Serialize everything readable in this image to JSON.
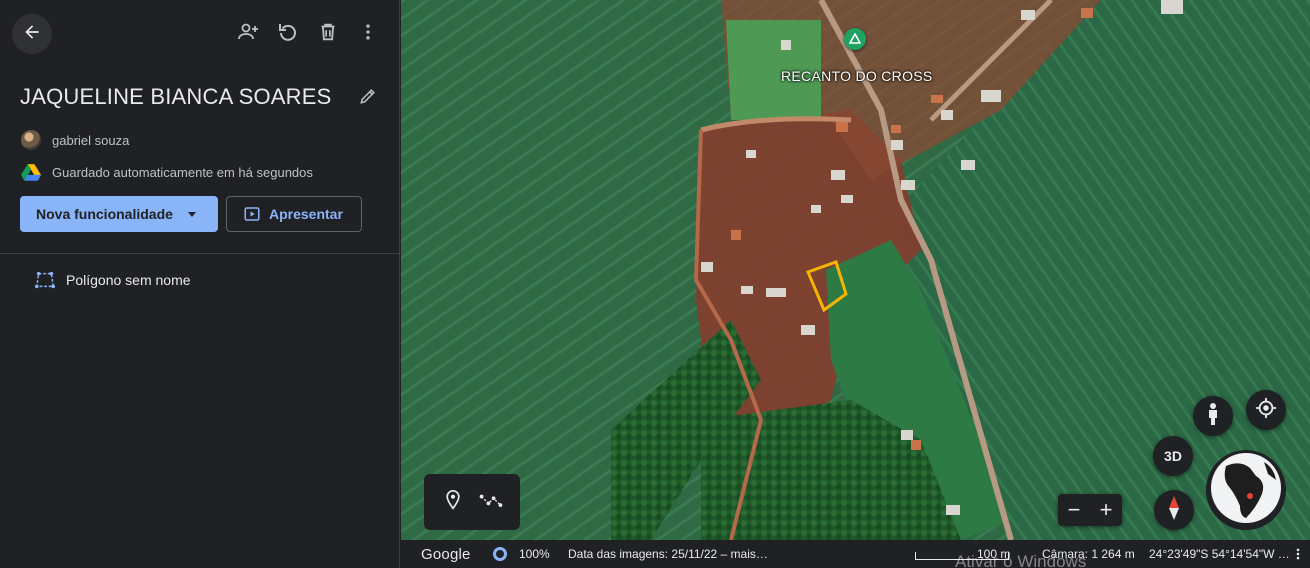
{
  "project": {
    "title": "JAQUELINE BIANCA SOARES",
    "owner": "gabriel souza",
    "save_status": "Guardado automaticamente em há segundos"
  },
  "toolbar": {
    "icons": [
      "back-arrow-icon",
      "add-person-icon",
      "undo-icon",
      "delete-icon",
      "more-vert-icon",
      "edit-pencil-icon"
    ]
  },
  "actions": {
    "new_feature_label": "Nova funcionalidade",
    "present_label": "Apresentar"
  },
  "features": [
    {
      "label": "Polígono sem nome",
      "icon": "polygon-icon"
    }
  ],
  "map": {
    "place_label": "RECANTO DO CROSS",
    "controls": {
      "three_d": "3D",
      "zoom_in": "+",
      "zoom_out": "−"
    },
    "polygon_color": "#f5b400",
    "pin_color": "#1ea362"
  },
  "status_bar": {
    "logo": "Google",
    "stream_percent": "100%",
    "imagery_date": "Data das imagens: 25/11/22 – mais…",
    "scale": "100 m",
    "camera": "Câmara: 1 264 m",
    "coordinates": "24°23'49\"S 54°14'54\"W …"
  },
  "watermark": "Ativar o Windows",
  "colors": {
    "panel_bg": "#202124",
    "accent": "#8ab4f8",
    "text": "#e8eaed",
    "muted_text": "#bdc1c6"
  }
}
